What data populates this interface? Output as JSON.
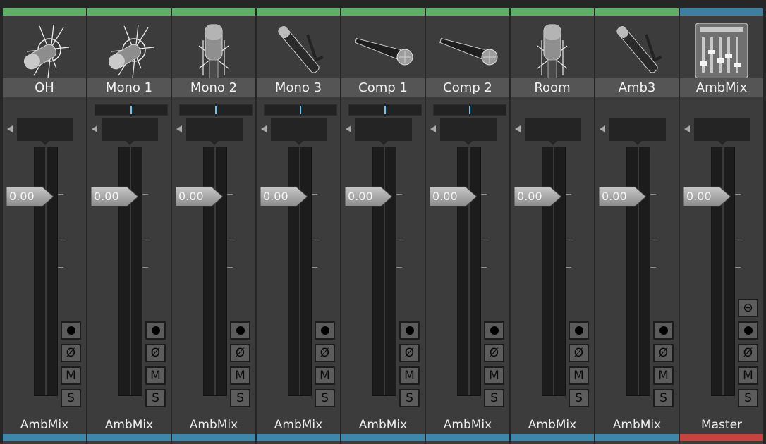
{
  "colors": {
    "track_top": "#5eb066",
    "bus_top": "#3d7fa0",
    "output_bus": "#3d87ab",
    "output_master": "#c6433e",
    "pan_marker": "#66c8ea"
  },
  "buttons": {
    "record": "●",
    "phase": "Ø",
    "mute": "M",
    "solo": "S",
    "stereo": "⊖"
  },
  "strips": [
    {
      "name": "OH",
      "icon": "condenser-mic-angled-icon",
      "gain": "0.00",
      "output": "AmbMix",
      "has_pan": false,
      "type": "track"
    },
    {
      "name": "Mono 1",
      "icon": "condenser-mic-angled-icon",
      "gain": "0.00",
      "output": "AmbMix",
      "has_pan": true,
      "type": "track"
    },
    {
      "name": "Mono 2",
      "icon": "studio-mic-icon",
      "gain": "0.00",
      "output": "AmbMix",
      "has_pan": true,
      "type": "track"
    },
    {
      "name": "Mono 3",
      "icon": "pencil-mic-icon",
      "gain": "0.00",
      "output": "AmbMix",
      "has_pan": true,
      "type": "track"
    },
    {
      "name": "Comp 1",
      "icon": "handheld-mic-icon",
      "gain": "0.00",
      "output": "AmbMix",
      "has_pan": true,
      "type": "track"
    },
    {
      "name": "Comp 2",
      "icon": "handheld-mic-icon",
      "gain": "0.00",
      "output": "AmbMix",
      "has_pan": true,
      "type": "track"
    },
    {
      "name": "Room",
      "icon": "studio-mic-icon",
      "gain": "0.00",
      "output": "AmbMix",
      "has_pan": false,
      "type": "track"
    },
    {
      "name": "Amb3",
      "icon": "pencil-mic-icon",
      "gain": "0.00",
      "output": "AmbMix",
      "has_pan": false,
      "type": "track"
    },
    {
      "name": "AmbMix",
      "icon": "mixer-console-icon",
      "gain": "0.00",
      "output": "Master",
      "has_pan": false,
      "type": "bus"
    }
  ]
}
